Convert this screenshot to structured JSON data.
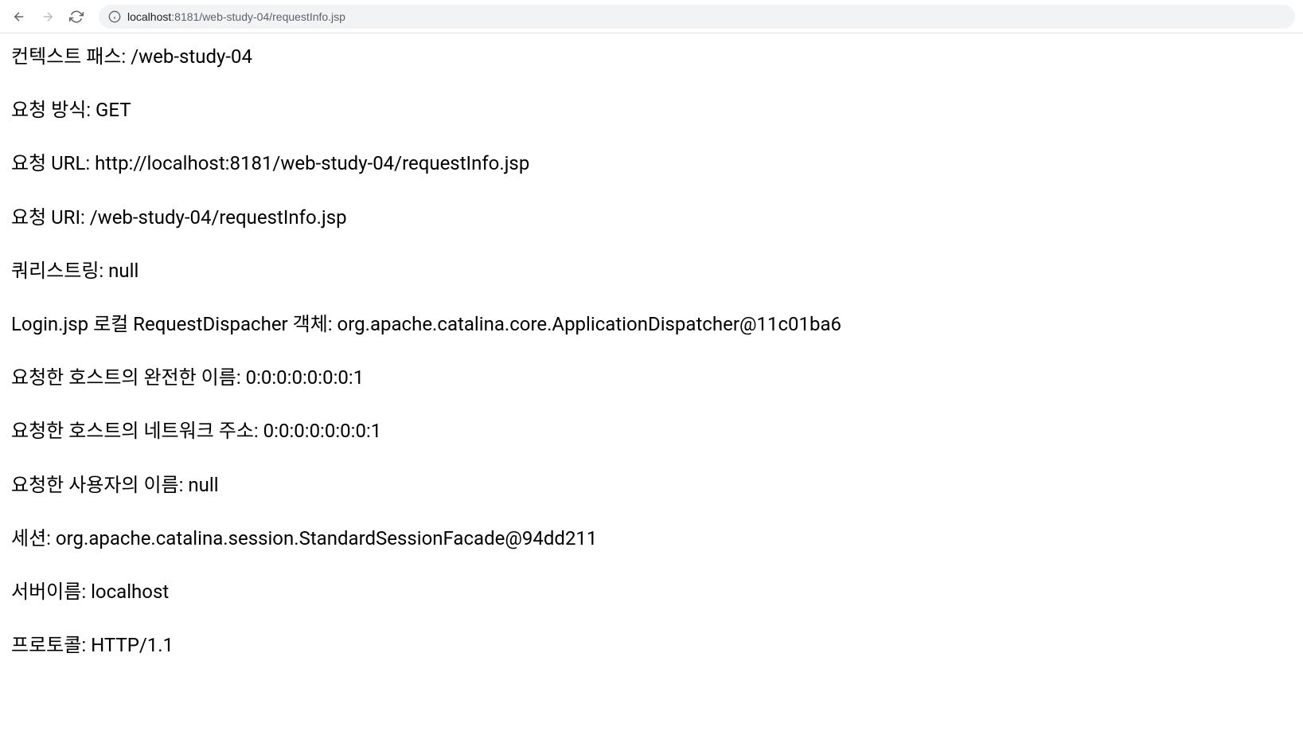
{
  "browser": {
    "url_host": "localhost",
    "url_path": ":8181/web-study-04/requestInfo.jsp"
  },
  "content": {
    "lines": [
      "컨텍스트 패스: /web-study-04",
      "요청 방식: GET",
      "요청 URL: http://localhost:8181/web-study-04/requestInfo.jsp",
      "요청 URI: /web-study-04/requestInfo.jsp",
      "쿼리스트링: null",
      "Login.jsp 로컬 RequestDispacher 객체: org.apache.catalina.core.ApplicationDispatcher@11c01ba6",
      "요청한 호스트의 완전한 이름: 0:0:0:0:0:0:0:1",
      "요청한 호스트의 네트워크 주소: 0:0:0:0:0:0:0:1",
      "요청한 사용자의 이름: null",
      "세션: org.apache.catalina.session.StandardSessionFacade@94dd211",
      "서버이름: localhost",
      "프로토콜: HTTP/1.1"
    ]
  }
}
